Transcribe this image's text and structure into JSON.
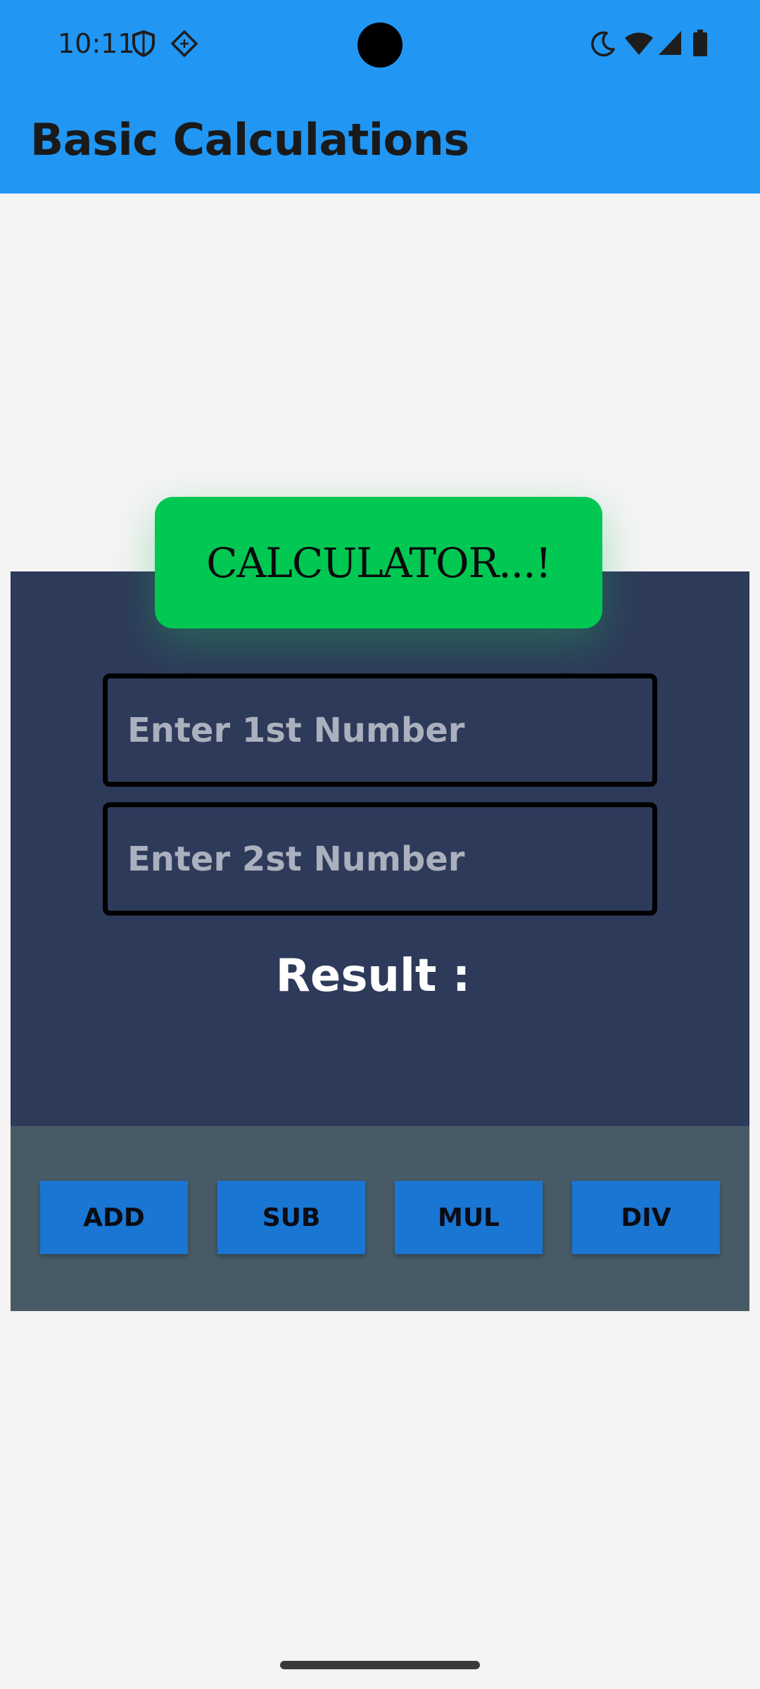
{
  "status_bar": {
    "time": "10:11",
    "left_icons": [
      "shield-icon",
      "vpn-diamond-icon"
    ],
    "right_icons": [
      "do-not-disturb-moon-icon",
      "wifi-icon",
      "cellular-signal-icon",
      "battery-icon"
    ]
  },
  "app_bar": {
    "title": "Basic Calculations",
    "background_color": "#2196f3"
  },
  "calculator": {
    "banner_text": "CALCULATOR...!",
    "banner_color": "#00c853",
    "panel_color": "#2e3a5a",
    "first_input": {
      "value": "",
      "placeholder": "Enter 1st Number"
    },
    "second_input": {
      "value": "",
      "placeholder": "Enter 2st Number"
    },
    "result_label": "Result :"
  },
  "operations": {
    "panel_color": "#475a66",
    "button_color": "#1976d2",
    "add_label": "ADD",
    "sub_label": "SUB",
    "mul_label": "MUL",
    "div_label": "DIV"
  }
}
